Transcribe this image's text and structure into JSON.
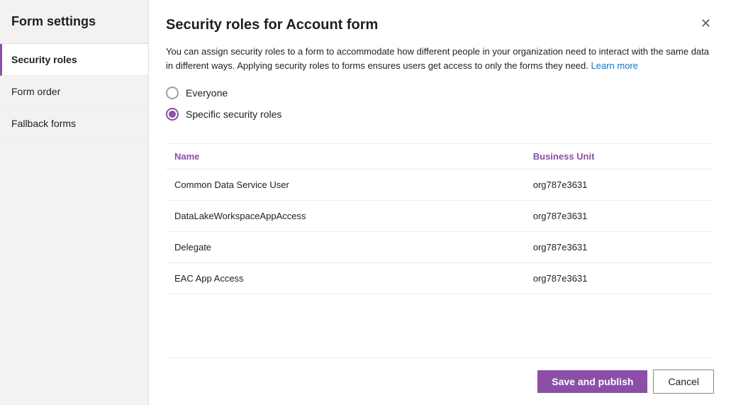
{
  "sidebar": {
    "title": "Form settings",
    "items": [
      {
        "id": "security-roles",
        "label": "Security roles",
        "active": true
      },
      {
        "id": "form-order",
        "label": "Form order",
        "active": false
      },
      {
        "id": "fallback-forms",
        "label": "Fallback forms",
        "active": false
      }
    ]
  },
  "dialog": {
    "title": "Security roles for Account form",
    "description": "You can assign security roles to a form to accommodate how different people in your organization need to interact with the same data in different ways. Applying security roles to forms ensures users get access to only the forms they need.",
    "learn_more_label": "Learn more",
    "radio_options": [
      {
        "id": "everyone",
        "label": "Everyone",
        "checked": false
      },
      {
        "id": "specific",
        "label": "Specific security roles",
        "checked": true
      }
    ],
    "table": {
      "columns": [
        {
          "key": "name",
          "label": "Name"
        },
        {
          "key": "business_unit",
          "label": "Business Unit"
        }
      ],
      "rows": [
        {
          "name": "Common Data Service User",
          "business_unit": "org787e3631"
        },
        {
          "name": "DataLakeWorkspaceAppAccess",
          "business_unit": "org787e3631"
        },
        {
          "name": "Delegate",
          "business_unit": "org787e3631"
        },
        {
          "name": "EAC App Access",
          "business_unit": "org787e3631"
        }
      ]
    },
    "buttons": {
      "save_label": "Save and publish",
      "cancel_label": "Cancel"
    }
  },
  "colors": {
    "accent": "#8b4fa8",
    "link": "#0078d4"
  }
}
